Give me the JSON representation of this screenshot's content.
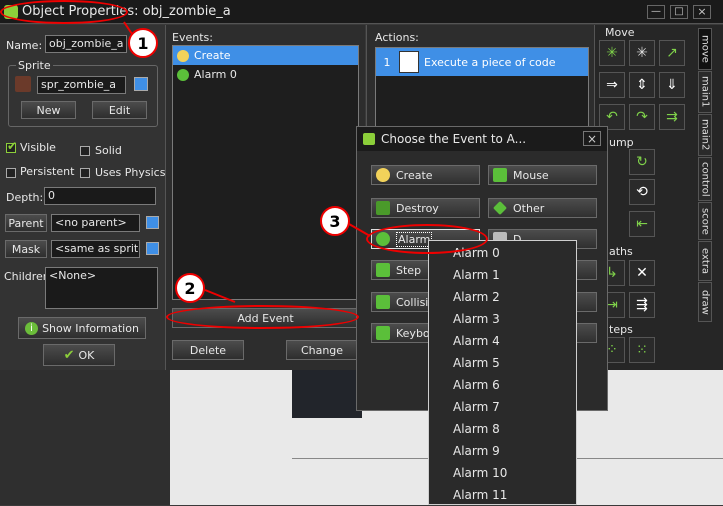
{
  "window": {
    "title": "Object Properties: obj_zombie_a"
  },
  "props": {
    "name_label": "Name:",
    "name_value": "obj_zombie_a",
    "sprite_group": "Sprite",
    "sprite_value": "spr_zombie_a",
    "new_label": "New",
    "edit_label": "Edit",
    "visible_label": "Visible",
    "solid_label": "Solid",
    "persistent_label": "Persistent",
    "physics_label": "Uses Physics",
    "depth_label": "Depth:",
    "depth_value": "0",
    "parent_label": "Parent",
    "parent_value": "<no parent>",
    "mask_label": "Mask",
    "mask_value": "<same as sprite>",
    "children_label": "Children:",
    "children_value": "<None>",
    "show_info_label": "Show Information",
    "ok_label": "OK"
  },
  "events": {
    "header": "Events:",
    "items": [
      "Create",
      "Alarm 0"
    ],
    "add_label": "Add Event",
    "delete_label": "Delete",
    "change_label": "Change"
  },
  "actions": {
    "header": "Actions:",
    "items": [
      {
        "num": "1",
        "label": "Execute a piece of code"
      }
    ]
  },
  "palette": {
    "move_header": "Move",
    "jump_header": "ump",
    "paths_header": "aths",
    "steps_header": "teps",
    "tabs": [
      "move",
      "main1",
      "main2",
      "control",
      "score",
      "extra",
      "draw"
    ]
  },
  "dialog": {
    "title": "Choose the Event to A...",
    "close": "×",
    "buttons": {
      "create": "Create",
      "mouse": "Mouse",
      "destroy": "Destroy",
      "other": "Other",
      "alarm": "Alarm",
      "draw": "D",
      "step": "Step",
      "collision": "Collisio",
      "keyboard": "Keyboa"
    }
  },
  "alarm_menu": [
    "Alarm 0",
    "Alarm 1",
    "Alarm 2",
    "Alarm 3",
    "Alarm 4",
    "Alarm 5",
    "Alarm 6",
    "Alarm 7",
    "Alarm 8",
    "Alarm 9",
    "Alarm 10",
    "Alarm 11"
  ],
  "callouts": [
    "1",
    "2",
    "3"
  ],
  "colors": {
    "accent": "#3f8fe6",
    "annotation": "#e00000",
    "icon_green": "#7fd14a"
  }
}
